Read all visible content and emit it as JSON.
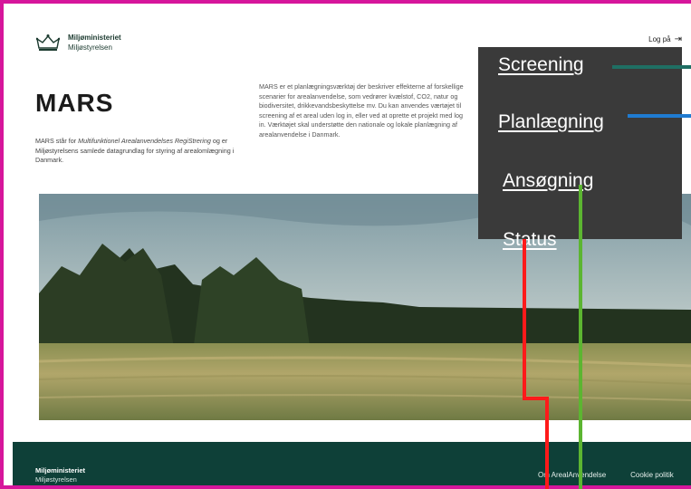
{
  "header": {
    "logo_title": "Miljøministeriet",
    "logo_subtitle": "Miljøstyrelsen",
    "login_label": "Log på",
    "login_icon": "sign-in-icon"
  },
  "hero": {
    "title": "MARS",
    "intro_prefix": "MARS står for ",
    "intro_italic": "Multifunktionel Arealanvendelses RegiStrering",
    "intro_suffix": " og er Miljøstyrelsens samlede datagrundlag for styring af arealomlægning i Danmark.",
    "description": "MARS er et planlægningsværktøj der beskriver effekterne af forskellige scenarier for arealanvendelse, som vedrører kvælstof, CO2, natur og biodiversitet, drikkevandsbeskyttelse mv. Du kan anvendes værtøjet til screening af et areal uden log in, eller ved at oprette et projekt med log in. Værktøjet skal understøtte den nationale og lokale planlægning af arealanvendelse i Danmark."
  },
  "menu": {
    "items": [
      {
        "label": "Screening"
      },
      {
        "label": "Planlægning"
      },
      {
        "label": "Ansøgning"
      },
      {
        "label": "Status"
      }
    ]
  },
  "footer": {
    "brand_title": "Miljøministeriet",
    "brand_subtitle": "Miljøstyrelsen",
    "links": [
      {
        "label": "Om ArealAnvendelse"
      },
      {
        "label": "Cookie politik"
      }
    ]
  },
  "colors": {
    "frame": "#d6169b",
    "footer": "#0e4038",
    "menu_panel": "#3a3a3a",
    "line_teal": "#1f6f63",
    "line_blue": "#1f7bd1",
    "line_green": "#5cb531",
    "line_red": "#ff1a1a"
  }
}
